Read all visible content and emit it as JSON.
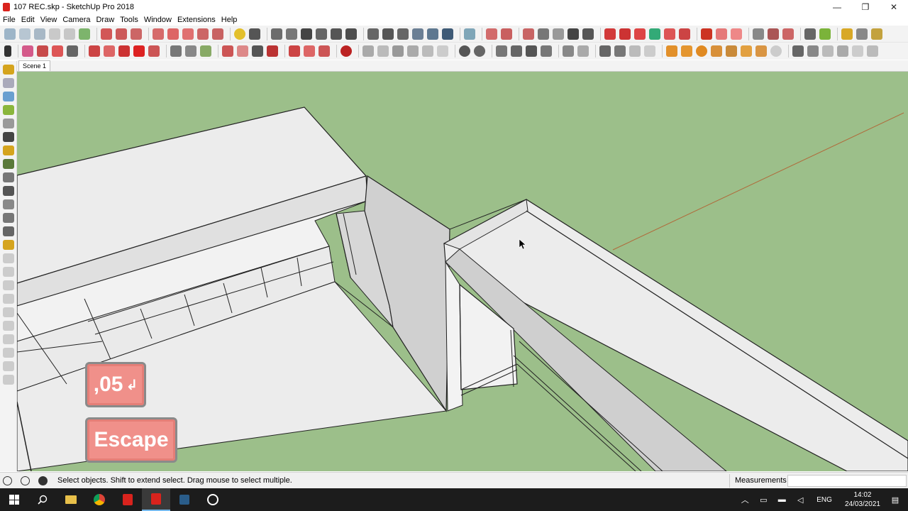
{
  "window": {
    "title": "107 REC.skp - SketchUp Pro 2018",
    "minimize": "—",
    "maximize": "❐",
    "close": "✕"
  },
  "menu": [
    "File",
    "Edit",
    "View",
    "Camera",
    "Draw",
    "Tools",
    "Window",
    "Extensions",
    "Help"
  ],
  "scene": {
    "tab_label": "Scene 1"
  },
  "overlays": {
    "key_value": ",05",
    "key_enter_glyph": "↲",
    "key_escape": "Escape"
  },
  "status": {
    "hint": "Select objects. Shift to extend select. Drag mouse to select multiple.",
    "measurements_label": "Measurements",
    "measurements_value": ""
  },
  "taskbar": {
    "language": "ENG",
    "time": "14:02",
    "date": "24/03/2021"
  },
  "colors": {
    "sky_ground": "#9cbf8a",
    "surface_light": "#ececec",
    "surface_shade": "#cfcfcf",
    "key_overlay": "#f0908a",
    "axis_red": "#b06a3a"
  }
}
